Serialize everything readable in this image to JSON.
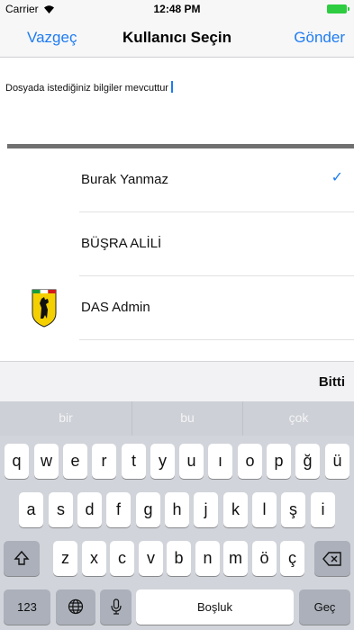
{
  "status": {
    "carrier": "Carrier",
    "wifi_icon": "wifi-icon",
    "time": "12:48 PM",
    "battery_color": "#2ecc40"
  },
  "nav": {
    "left": "Vazgeç",
    "title": "Kullanıcı Seçin",
    "right": "Gönder",
    "accent": "#1e7cf2"
  },
  "message": {
    "text": "Dosyada istediğiniz bilgiler mevcuttur"
  },
  "users": [
    {
      "name": "Burak Yanmaz",
      "selected": true
    },
    {
      "name": "BÜŞRA ALİLİ",
      "selected": false
    },
    {
      "name": "DAS Admin",
      "selected": false,
      "avatar": "ferrari-logo"
    }
  ],
  "accessory": {
    "done": "Bitti"
  },
  "keyboard": {
    "suggestions": [
      "bir",
      "bu",
      "çok"
    ],
    "row1": [
      "q",
      "w",
      "e",
      "r",
      "t",
      "y",
      "u",
      "ı",
      "o",
      "p",
      "ğ",
      "ü"
    ],
    "row2": [
      "a",
      "s",
      "d",
      "f",
      "g",
      "h",
      "j",
      "k",
      "l",
      "ş",
      "i"
    ],
    "row3": [
      "z",
      "x",
      "c",
      "v",
      "b",
      "n",
      "m",
      "ö",
      "ç"
    ],
    "numbers": "123",
    "space": "Boşluk",
    "go": "Geç",
    "shift_icon": "shift-icon",
    "delete_icon": "backspace-icon",
    "globe_icon": "globe-icon",
    "mic_icon": "microphone-icon"
  }
}
